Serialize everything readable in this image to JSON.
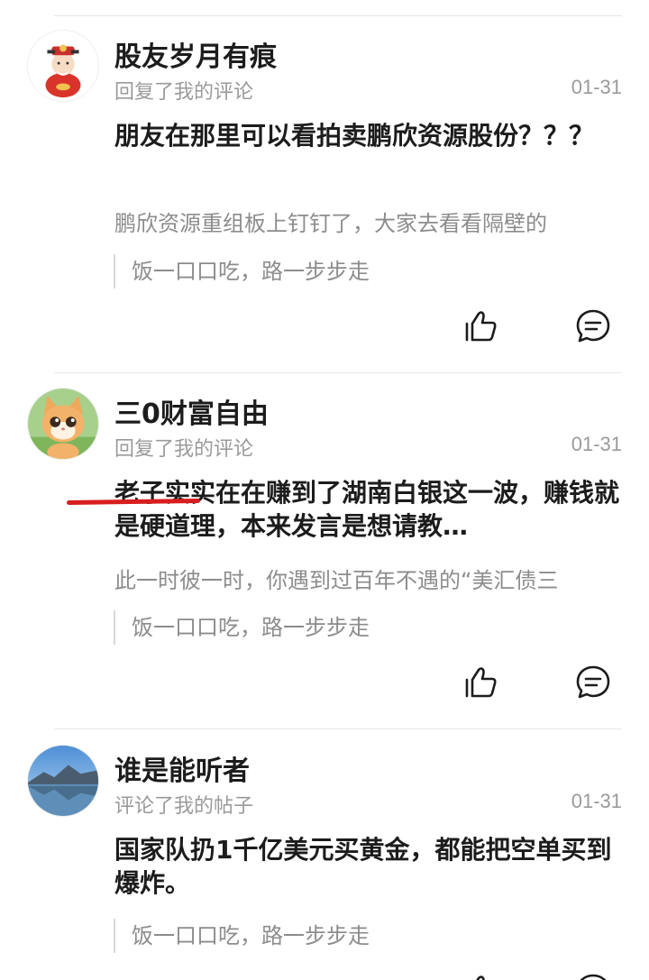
{
  "notifications": [
    {
      "username": "股友岁月有痕",
      "action": "回复了我的评论",
      "date": "01-31",
      "reply": "朋友在那里可以看拍卖鹏欣资源股份？？？",
      "quote": "鹏欣资源重组板上钉钉了，大家去看看隔壁的",
      "original": "饭一口口吃，路一步步走",
      "avatar": "fortune-god-avatar"
    },
    {
      "username": "三0财富自由",
      "action": "回复了我的评论",
      "date": "01-31",
      "reply": "老子实实在在赚到了湖南白银这一波，赚钱就是硬道理，本来发言是想请教…",
      "quote": "此一时彼一时，你遇到过百年不遇的“美汇债三",
      "original": "饭一口口吃，路一步步走",
      "avatar": "cartoon-cat-avatar"
    },
    {
      "username": "谁是能听者",
      "action": "评论了我的帖子",
      "date": "01-31",
      "reply": "国家队扔1千亿美元买黄金，都能把空单买到爆炸。",
      "original": "饭一口口吃，路一步步走",
      "avatar": "lake-landscape-avatar"
    }
  ],
  "icons": {
    "like": "thumbs-up-icon",
    "comment": "comment-bubble-icon"
  },
  "colors": {
    "annotation": "#d81e1e",
    "secondary_text": "#9a9a9a",
    "primary_text": "#1c1c1c"
  }
}
